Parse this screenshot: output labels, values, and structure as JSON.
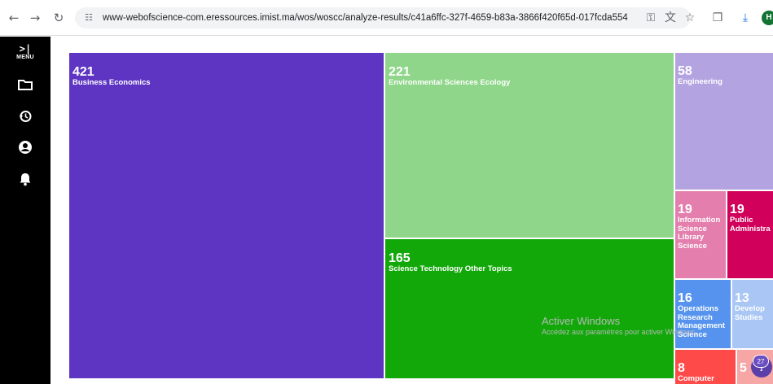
{
  "browser": {
    "back_icon": "←",
    "forward_icon": "→",
    "reload_icon": "↻",
    "site_info_icon": "☷",
    "url": "www-webofscience-com.eressources.imist.ma/wos/woscc/analyze-results/c41a6ffc-327f-4659-b83a-3866f420f65d-017fcda554",
    "password_icon": "⚿",
    "translate_icon": "文",
    "bookmark_icon": "☆",
    "extensions_icon": "❐",
    "download_icon": "⤓",
    "profile_initial": "H"
  },
  "sidebar": {
    "menu_chevron": ">|",
    "menu_label": "MENU",
    "items": [
      {
        "name": "folder-icon"
      },
      {
        "name": "history-icon"
      },
      {
        "name": "account-icon"
      },
      {
        "name": "bell-icon"
      }
    ]
  },
  "treemap": {
    "tiles": [
      {
        "count": "421",
        "label": "Business Economics",
        "color": "#5e35c2"
      },
      {
        "count": "221",
        "label": "Environmental Sciences Ecology",
        "color": "#8fd68a"
      },
      {
        "count": "165",
        "label": "Science Technology Other Topics",
        "color": "#12a80a"
      },
      {
        "count": "58",
        "label": "Engineering",
        "color": "#b3a3e0"
      },
      {
        "count": "19",
        "label": "Information Science Library Science",
        "color": "#e47fad"
      },
      {
        "count": "19",
        "label": "Public Administra",
        "color": "#d1005a"
      },
      {
        "count": "16",
        "label": "Operations Research Management Science",
        "color": "#5593ee"
      },
      {
        "count": "13",
        "label": "Develop Studies",
        "color": "#a9c6f5"
      },
      {
        "count": "8",
        "label": "Computer",
        "color": "#ff4a4a"
      },
      {
        "count": "5",
        "label": "",
        "color": "#f7a6a6"
      }
    ]
  },
  "overlay": {
    "watermark_title": "Activer Windows",
    "watermark_sub": "Accédez aux paramètres pour activer Windows.",
    "help_badge": "27",
    "help_glyph": "?"
  }
}
